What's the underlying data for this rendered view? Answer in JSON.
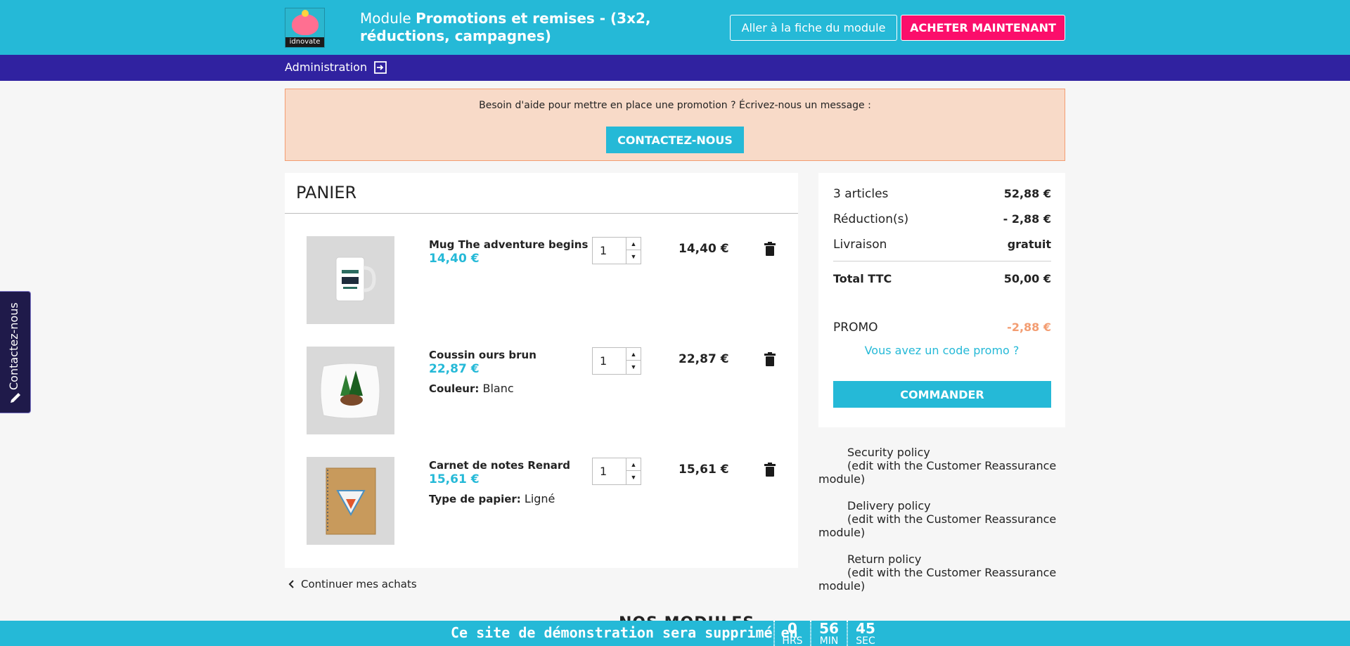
{
  "header": {
    "logo_text": "idnovate",
    "title_prefix": "Module ",
    "title_bold": "Promotions et remises - (3x2, réductions, campagnes)",
    "module_page_label": "Aller à la fiche du module",
    "buy_label": "ACHETER MAINTENANT"
  },
  "adminbar": {
    "label": "Administration"
  },
  "help": {
    "text": "Besoin d'aide pour mettre en place une promotion ? Écrivez-nous un message :",
    "button": "CONTACTEZ-NOUS"
  },
  "cart": {
    "title": "PANIER",
    "items": [
      {
        "name": "Mug The adventure begins",
        "price": "14,40 €",
        "attr_label": "",
        "attr_value": "",
        "qty": "1",
        "total": "14,40 €"
      },
      {
        "name": "Coussin ours brun",
        "price": "22,87 €",
        "attr_label": "Couleur:",
        "attr_value": " Blanc",
        "qty": "1",
        "total": "22,87 €"
      },
      {
        "name": "Carnet de notes Renard",
        "price": "15,61 €",
        "attr_label": "Type de papier:",
        "attr_value": " Ligné",
        "qty": "1",
        "total": "15,61 €"
      }
    ],
    "continue_label": "Continuer mes achats"
  },
  "summary": {
    "articles_label": "3 articles",
    "articles_value": "52,88 €",
    "reductions_label": "Réduction(s)",
    "reductions_value": "- 2,88 €",
    "shipping_label": "Livraison",
    "shipping_value": "gratuit",
    "total_label": "Total TTC",
    "total_value": "50,00 €",
    "promo_label": "PROMO",
    "promo_value": "-2,88 €",
    "promo_link": "Vous avez un code promo ?",
    "order_button": "COMMANDER"
  },
  "reassurance": [
    {
      "title": "Security policy",
      "sub": "(edit with the Customer Reassurance",
      "sub2": "module)"
    },
    {
      "title": "Delivery policy",
      "sub": "(edit with the Customer Reassurance",
      "sub2": "module)"
    },
    {
      "title": "Return policy",
      "sub": "(edit with the Customer Reassurance",
      "sub2": "module)"
    }
  ],
  "side_tab": {
    "label": "Contactez-nous"
  },
  "footer": {
    "partial_heading": "NOS MODULES",
    "countdown_text": "Ce site de démonstration sera supprimé en",
    "hours": "0",
    "hours_label": "HRS",
    "minutes": "56",
    "minutes_label": "MIN",
    "seconds": "45",
    "seconds_label": "SEC"
  },
  "colors": {
    "accent": "#25b9d7",
    "admin_bar": "#3022a0",
    "buy_button": "#fb0e6b",
    "promo": "#f39d72"
  }
}
